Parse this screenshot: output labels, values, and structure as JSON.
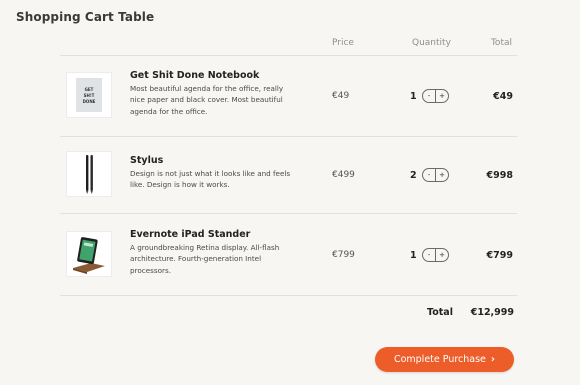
{
  "page": {
    "title": "Shopping Cart Table"
  },
  "columns": {
    "price": "Price",
    "quantity": "Quantity",
    "total": "Total"
  },
  "items": [
    {
      "name": "Get Shit Done Notebook",
      "description": "Most beautiful agenda for the office, really nice paper and black cover. Most beautiful agenda for the office.",
      "price": "€49",
      "quantity": "1",
      "total": "€49",
      "cover_text": [
        "GET",
        "SH!T",
        "DONE"
      ]
    },
    {
      "name": "Stylus",
      "description": "Design is not just what it looks like and feels like. Design is how it works.",
      "price": "€499",
      "quantity": "2",
      "total": "€998"
    },
    {
      "name": "Evernote iPad Stander",
      "description": "A groundbreaking Retina display. All-flash architecture. Fourth-generation Intel processors.",
      "price": "€799",
      "quantity": "1",
      "total": "€799"
    }
  ],
  "stepper": {
    "minus": "-",
    "plus": "+"
  },
  "summary": {
    "label": "Total",
    "value": "€12,999"
  },
  "checkout": {
    "label": "Complete Purchase",
    "chevron": "›"
  },
  "colors": {
    "accent": "#ec5d29",
    "background": "#f8f6f3"
  }
}
